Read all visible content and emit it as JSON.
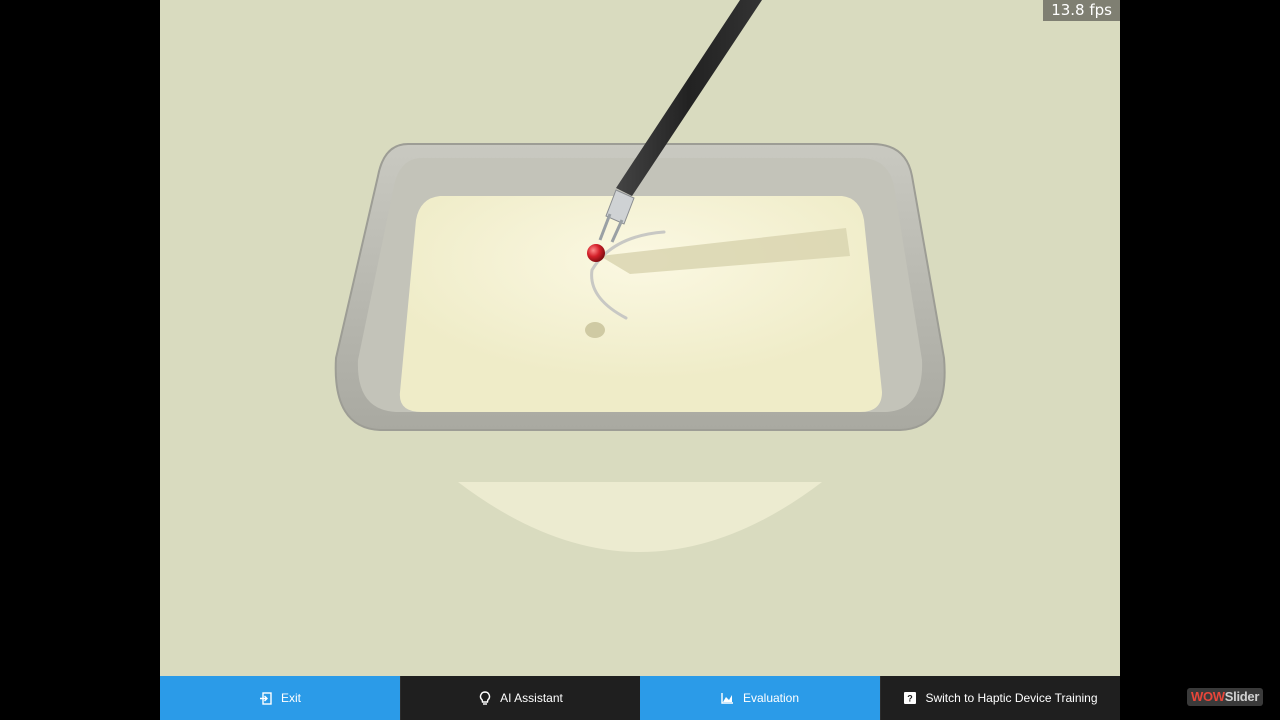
{
  "overlay": {
    "fps": "13.8 fps"
  },
  "toolbar": {
    "exit": {
      "label": "Exit",
      "icon": "exit-icon",
      "color": "#2b9be8"
    },
    "ai_assistant": {
      "label": "AI Assistant",
      "icon": "lightbulb-icon",
      "color": "#1f1f1f"
    },
    "evaluation": {
      "label": "Evaluation",
      "icon": "chart-icon",
      "color": "#2b9be8"
    },
    "haptic": {
      "label": "Switch to Haptic Device Training",
      "icon": "question-icon",
      "color": "#1f1f1f"
    }
  },
  "watermark": {
    "part1": "WOW",
    "part2": "Slider"
  },
  "colors": {
    "background": "#d9dbbf",
    "tray": "#b8b8ae",
    "marker": "#d4202a"
  }
}
